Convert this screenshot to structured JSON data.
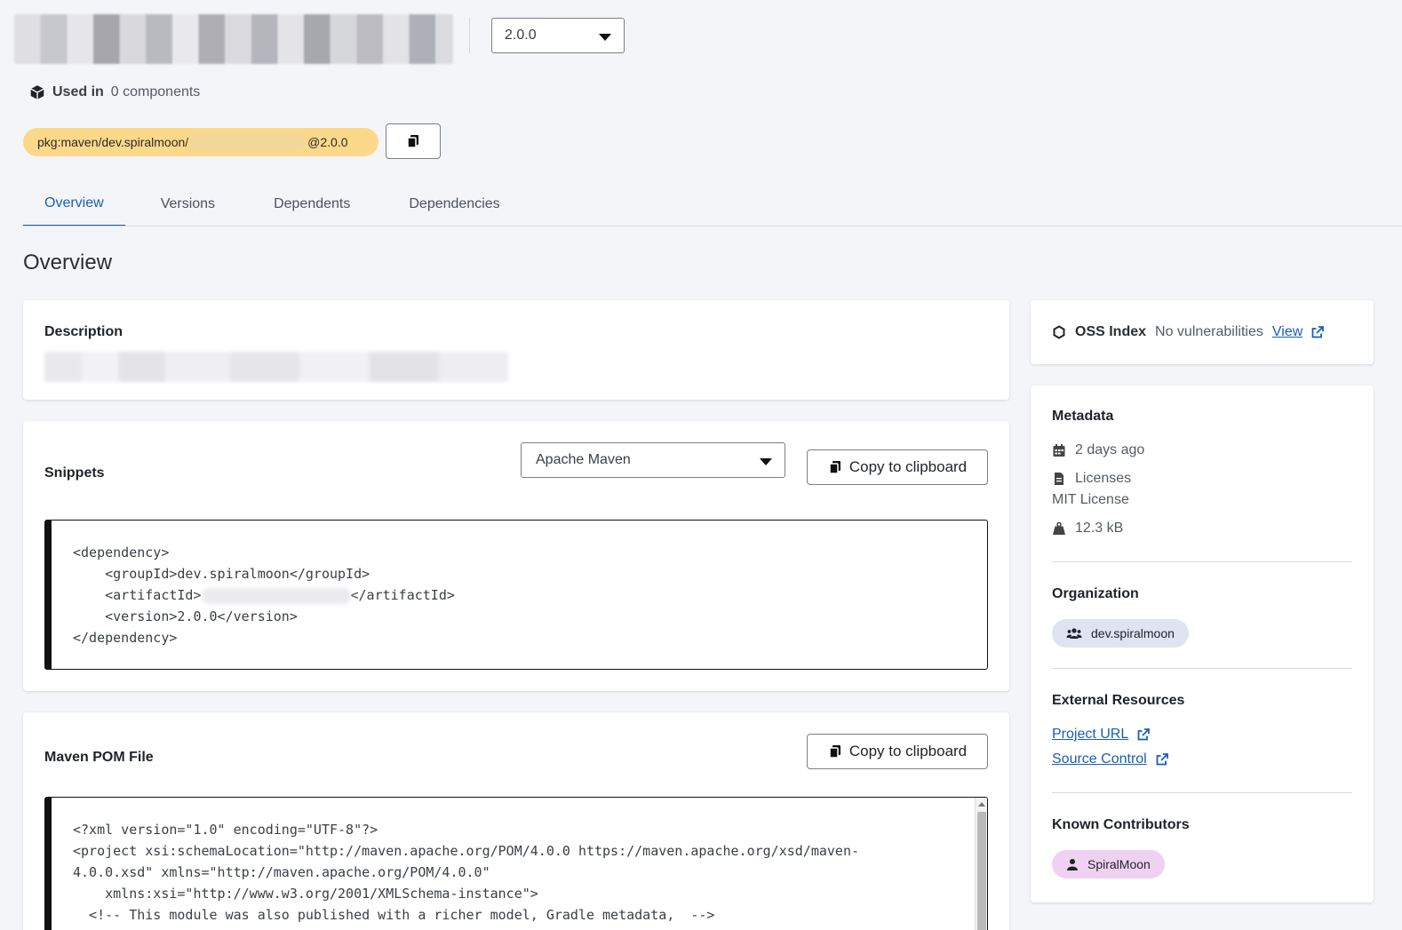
{
  "header": {
    "version": "2.0.0",
    "used_in_label": "Used in",
    "used_in_value": "0 components",
    "purl_prefix": "pkg:maven/dev.spiralmoon/",
    "purl_suffix": "@2.0.0"
  },
  "tabs": [
    {
      "label": "Overview",
      "active": true
    },
    {
      "label": "Versions",
      "active": false
    },
    {
      "label": "Dependents",
      "active": false
    },
    {
      "label": "Dependencies",
      "active": false
    }
  ],
  "page_title": "Overview",
  "description": {
    "title": "Description"
  },
  "snippets": {
    "title": "Snippets",
    "selected_tool": "Apache Maven",
    "copy_label": "Copy to clipboard",
    "code": {
      "line1": "<dependency>",
      "line2": "    <groupId>dev.spiralmoon</groupId>",
      "line3_start": "    <artifactId>",
      "line3_end": "</artifactId>",
      "line4": "    <version>2.0.0</version>",
      "line5": "</dependency>"
    }
  },
  "pom": {
    "title": "Maven POM File",
    "copy_label": "Copy to clipboard",
    "lines": [
      "<?xml version=\"1.0\" encoding=\"UTF-8\"?>",
      "<project xsi:schemaLocation=\"http://maven.apache.org/POM/4.0.0 https://maven.apache.org/xsd/maven-",
      "4.0.0.xsd\" xmlns=\"http://maven.apache.org/POM/4.0.0\"",
      "    xmlns:xsi=\"http://www.w3.org/2001/XMLSchema-instance\">",
      "  <!-- This module was also published with a richer model, Gradle metadata,  -->"
    ]
  },
  "oss": {
    "name": "OSS Index",
    "status": "No vulnerabilities",
    "link": "View"
  },
  "metadata": {
    "title": "Metadata",
    "updated": "2 days ago",
    "licenses_label": "Licenses",
    "license": "MIT License",
    "size": "12.3 kB",
    "organization_title": "Organization",
    "organization": "dev.spiralmoon",
    "external_title": "External Resources",
    "project_url": "Project URL",
    "source_control": "Source Control",
    "contributors_title": "Known Contributors",
    "contributor": "SpiralMoon"
  },
  "colors": {
    "accent": "#1a5fb4",
    "purl_bg": "#fcd98a",
    "org_chip": "#dfe3f2",
    "contrib_chip": "#efd2f2"
  }
}
